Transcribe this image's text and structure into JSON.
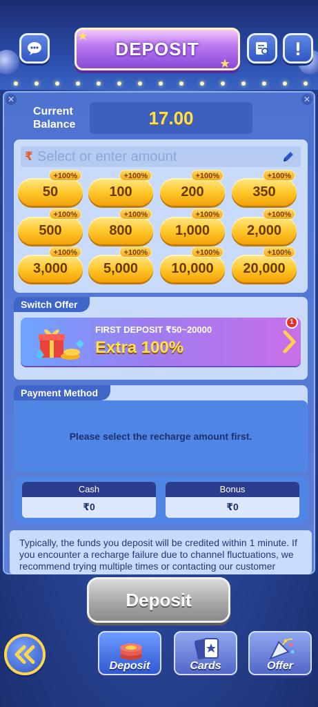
{
  "header": {
    "title": "DEPOSIT",
    "left_icon": "chat-bubble-icon",
    "right_icons": [
      "notebook-search-icon",
      "exclamation-icon"
    ]
  },
  "balance": {
    "label": "Current Balance",
    "value": "17.00"
  },
  "amount": {
    "currency_symbol": "₹",
    "placeholder": "Select or enter amount",
    "bonus_label": "+100%",
    "options": [
      "50",
      "100",
      "200",
      "350",
      "500",
      "800",
      "1,000",
      "2,000",
      "3,000",
      "5,000",
      "10,000",
      "20,000"
    ]
  },
  "offer": {
    "section_label": "Switch Offer",
    "title": "FIRST DEPOSIT ₹50~20000",
    "highlight": "Extra 100%",
    "badge_count": "1"
  },
  "payment": {
    "section_label": "Payment Method",
    "message": "Please select the recharge amount first."
  },
  "wallets": {
    "cash_label": "Cash",
    "cash_value": "₹0",
    "bonus_label": "Bonus",
    "bonus_value": "₹0"
  },
  "note": {
    "text": "Typically, the funds you deposit will be credited within 1 minute. If you encounter a recharge failure due to channel fluctuations, we recommend trying multiple times or contacting our customer"
  },
  "actions": {
    "deposit_label": "Deposit"
  },
  "nav": {
    "items": [
      {
        "label": "Deposit",
        "icon": "chips-icon"
      },
      {
        "label": "Cards",
        "icon": "cards-icon"
      },
      {
        "label": "Offer",
        "icon": "party-popper-icon"
      }
    ],
    "back_icon": "double-chevron-left-icon"
  },
  "colors": {
    "accent_gold": "#ffc526",
    "panel_blue": "#4d72cf",
    "balance_yellow": "#ffe04a"
  }
}
